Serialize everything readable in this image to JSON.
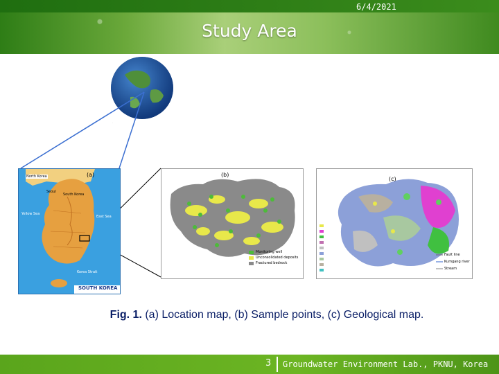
{
  "header": {
    "date": "6/4/2021",
    "title": "Study Area"
  },
  "figures": {
    "map_a": {
      "label": "(a)",
      "country_label": "SOUTH KOREA",
      "places": [
        "North Korea",
        "South Korea",
        "Yellow Sea",
        "East Sea",
        "Korea Strait",
        "Seoul"
      ]
    },
    "map_b": {
      "label": "(b)",
      "legend": [
        "Monitoring well",
        "Unconsolidated deposits",
        "Fractured bedrock"
      ]
    },
    "map_c": {
      "label": "(c)",
      "legend_lines": [
        "Fault line",
        "Kumgang river",
        "Stream"
      ]
    }
  },
  "caption": {
    "fig_label": "Fig. 1.",
    "text": " (a) Location map, (b) Sample points, (c) Geological map."
  },
  "footer": {
    "page_number": "3",
    "lab": "Groundwater Environment Lab., PKNU, Korea"
  },
  "colors": {
    "header_green": "#3b8c1c",
    "footer_green": "#6cb523",
    "caption_blue": "#0a1e66"
  }
}
